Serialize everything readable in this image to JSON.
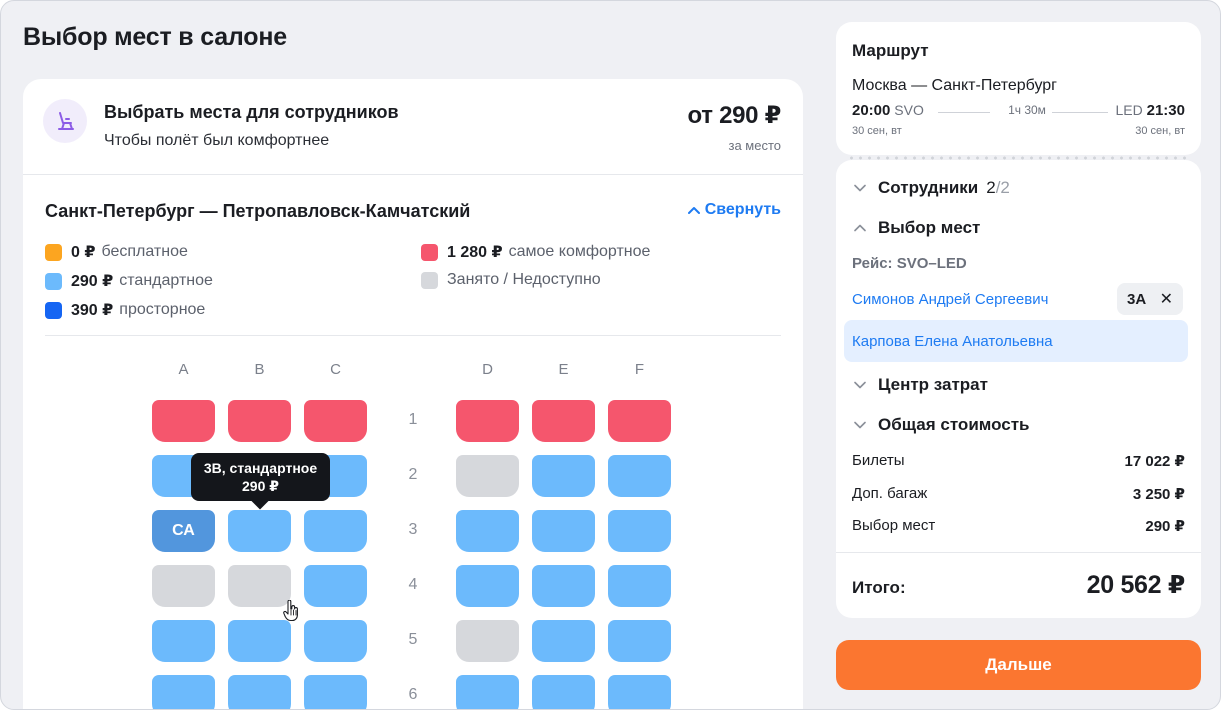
{
  "page_title": "Выбор мест в салоне",
  "promo": {
    "title": "Выбрать места для сотрудников",
    "subtitle": "Чтобы полёт был комфортнее",
    "price": "от 290 ₽",
    "price_unit": "за место",
    "icon": "seat-icon",
    "accent": "#8c5ce6"
  },
  "seatmap": {
    "route": "Санкт-Петербург — Петропавловск-Камчатский",
    "collapse_label": "Свернуть",
    "legend": [
      {
        "price": "0 ₽",
        "label": "бесплатное",
        "color": "#fca520"
      },
      {
        "price": "290 ₽",
        "label": "стандартное",
        "color": "#6cbafc"
      },
      {
        "price": "390 ₽",
        "label": "просторное",
        "color": "#1565f3"
      },
      {
        "price": "1 280 ₽",
        "label": "самое комфортное",
        "color": "#f5566d"
      },
      {
        "price": "",
        "label": "Занято / Недоступно",
        "color": "#d6d8dc"
      }
    ],
    "columns": [
      "A",
      "B",
      "C",
      "D",
      "E",
      "F"
    ],
    "rows": [
      "1",
      "2",
      "3",
      "4",
      "5",
      "6"
    ],
    "seat_rows": [
      [
        "red",
        "red",
        "red",
        "red",
        "red",
        "red"
      ],
      [
        "blue",
        "blue",
        "blue",
        "grey",
        "blue",
        "blue"
      ],
      [
        "selected",
        "blue",
        "blue",
        "blue",
        "blue",
        "blue"
      ],
      [
        "grey",
        "grey",
        "blue",
        "blue",
        "blue",
        "blue"
      ],
      [
        "blue",
        "blue",
        "blue",
        "grey",
        "blue",
        "blue"
      ],
      [
        "blue",
        "blue",
        "blue",
        "blue",
        "blue",
        "blue"
      ]
    ],
    "selected_seat_label": "СА",
    "tooltip": {
      "line1": "3B, стандартное",
      "line2": "290 ₽"
    }
  },
  "route_card": {
    "title": "Маршрут",
    "cities": "Москва — Санкт-Петербург",
    "dep_time": "20:00",
    "dep_code": "SVO",
    "duration": "1ч 30м",
    "arr_code": "LED",
    "arr_time": "21:30",
    "dep_date": "30 сен, вт",
    "arr_date": "30 сен, вт"
  },
  "summary": {
    "employees_label": "Сотрудники",
    "employees_count": "2",
    "employees_total": "/2",
    "seats_label": "Выбор мест",
    "flight": "Рейс: SVO–LED",
    "passengers": [
      {
        "name": "Симонов Андрей Сергеевич",
        "seat": "3A"
      },
      {
        "name": "Карпова Елена Анатольевна",
        "seat": ""
      }
    ],
    "chip_remove": "✕",
    "cost_center_label": "Центр затрат",
    "total_cost_label": "Общая стоимость",
    "costs": [
      {
        "label": "Билеты",
        "value": "17 022 ₽"
      },
      {
        "label": "Доп. багаж",
        "value": "3 250 ₽"
      },
      {
        "label": "Выбор мест",
        "value": "290 ₽"
      }
    ],
    "total_label": "Итого:",
    "total_value": "20 562 ₽"
  },
  "next_button": "Дальше",
  "colors": {
    "primary_link": "#1e7bf2",
    "cta": "#fb7630"
  }
}
